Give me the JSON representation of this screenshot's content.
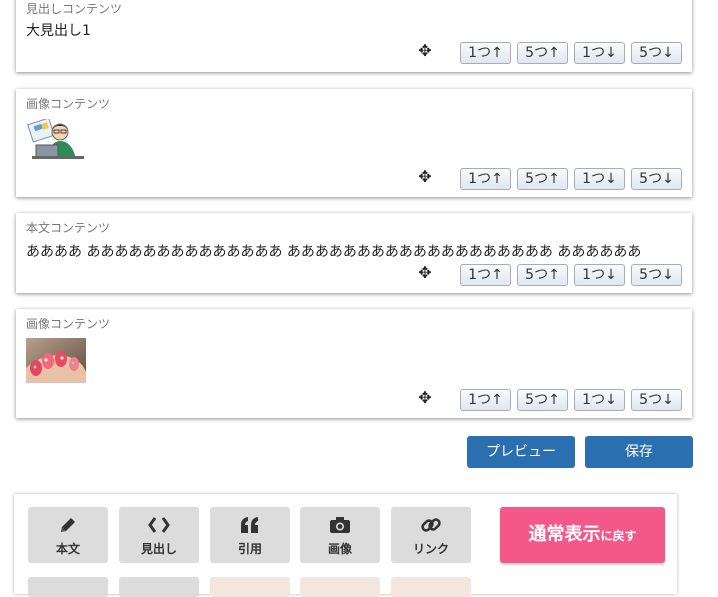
{
  "cards": [
    {
      "label": "見出しコンテンツ",
      "text": "大見出し1"
    },
    {
      "label": "画像コンテンツ",
      "image": "person-at-laptop-illustration"
    },
    {
      "label": "本文コンテンツ",
      "text": "ああああ ああああああああああああああ あああああああああああああああああああ ああああああ"
    },
    {
      "label": "画像コンテンツ",
      "image": "painted-nails-photo"
    }
  ],
  "move_buttons": [
    "1つ↑",
    "5つ↑",
    "1つ↓",
    "5つ↓"
  ],
  "move_icon": "✥",
  "actions": {
    "preview": "プレビュー",
    "save": "保存"
  },
  "toolbar": {
    "buttons": [
      {
        "label": "本文",
        "icon": "pencil-icon"
      },
      {
        "label": "見出し",
        "icon": "code-icon"
      },
      {
        "label": "引用",
        "icon": "quote-icon"
      },
      {
        "label": "画像",
        "icon": "camera-icon"
      },
      {
        "label": "リンク",
        "icon": "link-icon"
      }
    ],
    "return_big": "通常表示",
    "return_small": "に戻す"
  },
  "colors": {
    "primary": "#2a6fb0",
    "pink": "#f4588a",
    "toolbar_button": "#dcdcdc"
  }
}
